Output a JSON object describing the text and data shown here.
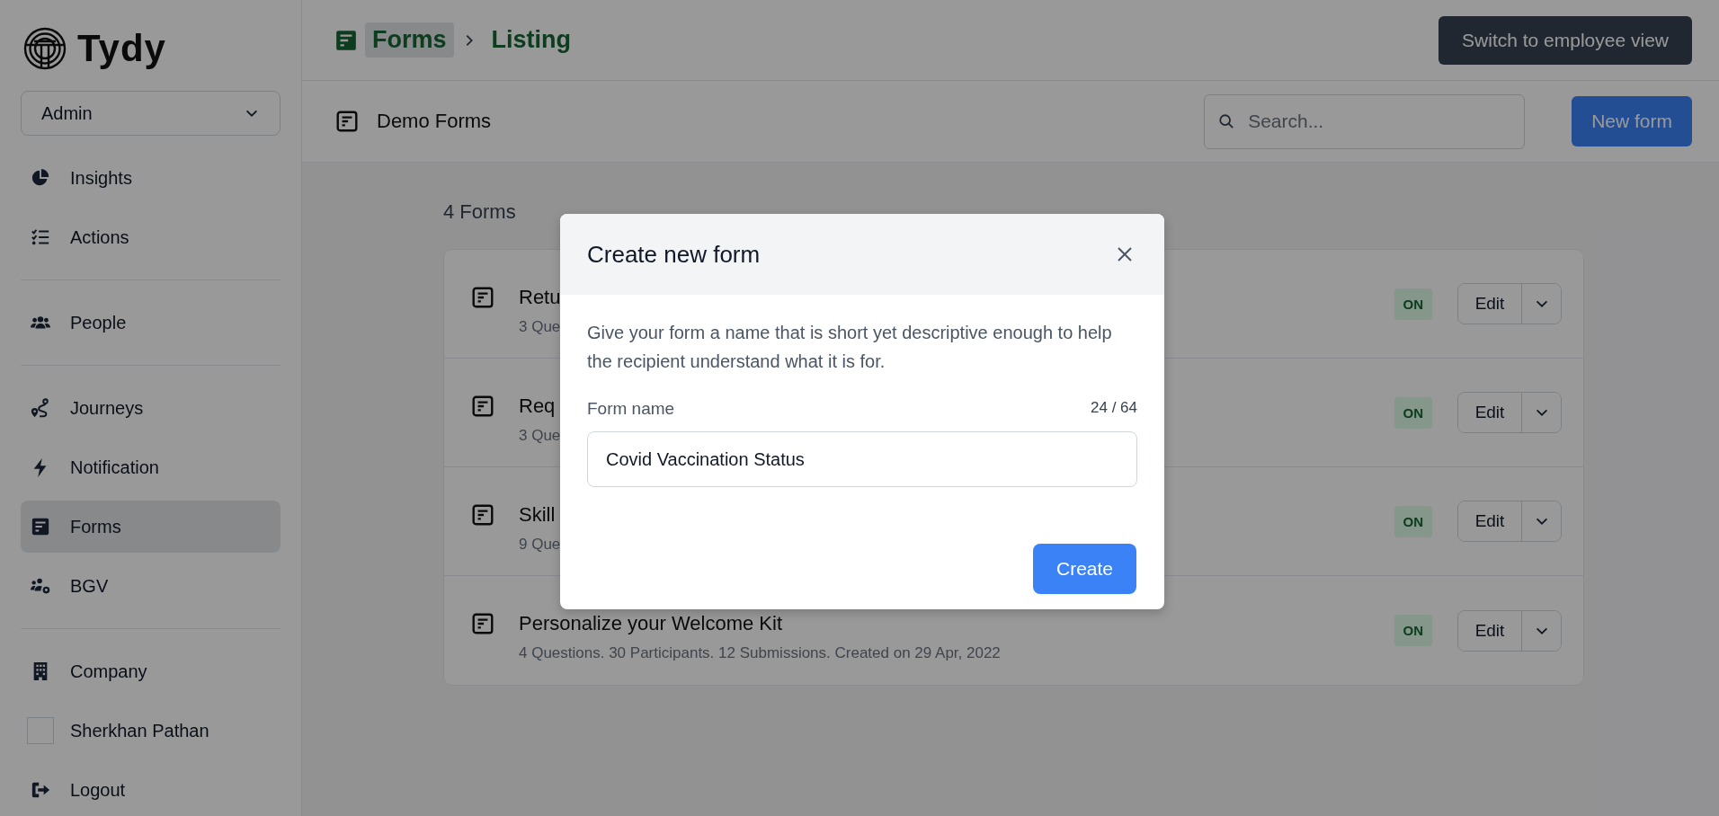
{
  "logo": {
    "text": "Tydy"
  },
  "role_select": {
    "value": "Admin"
  },
  "sidebar": {
    "groups": [
      {
        "items": [
          {
            "kind": "nav",
            "label": "Insights",
            "selected": false
          },
          {
            "kind": "nav",
            "label": "Actions",
            "selected": false
          }
        ]
      },
      {
        "items": [
          {
            "kind": "nav",
            "label": "People",
            "selected": false
          }
        ]
      },
      {
        "items": [
          {
            "kind": "nav",
            "label": "Journeys",
            "selected": false
          },
          {
            "kind": "nav",
            "label": "Notification",
            "selected": false
          },
          {
            "kind": "nav",
            "label": "Forms",
            "selected": true
          },
          {
            "kind": "nav",
            "label": "BGV",
            "selected": false
          }
        ]
      },
      {
        "items": [
          {
            "kind": "nav",
            "label": "Company",
            "selected": false
          },
          {
            "kind": "user",
            "label": "Sherkhan Pathan",
            "selected": false
          },
          {
            "kind": "nav",
            "label": "Logout",
            "selected": false
          }
        ]
      }
    ]
  },
  "breadcrumb": [
    {
      "label": "Forms",
      "hovered": true
    },
    {
      "label": "Listing",
      "hovered": false
    }
  ],
  "switch_button": "Switch to employee view",
  "subheader": {
    "title": "Demo Forms",
    "search": {
      "placeholder": "Search..."
    },
    "new_button": "New form"
  },
  "count": "4 Forms",
  "forms": [
    {
      "title": "Retu",
      "meta": "3 Que",
      "status": "ON",
      "on": true,
      "edit": "Edit"
    },
    {
      "title": "Req",
      "meta": "3 Que",
      "status": "ON",
      "on": true,
      "edit": "Edit"
    },
    {
      "title": "Skill",
      "meta": "9 Que",
      "status": "ON",
      "on": true,
      "edit": "Edit"
    },
    {
      "title": "Personalize your Welcome Kit",
      "meta": "4 Questions. 30 Participants. 12 Submissions. Created on 29 Apr, 2022",
      "status": "ON",
      "on": true,
      "edit": "Edit"
    }
  ],
  "modal": {
    "title": "Create new form",
    "description": "Give your form a name that is short yet descriptive enough to help the recipient understand what it is for.",
    "field_label": "Form name",
    "counter": "24 / 64",
    "value": "Covid Vaccination Status",
    "button": "Create"
  }
}
